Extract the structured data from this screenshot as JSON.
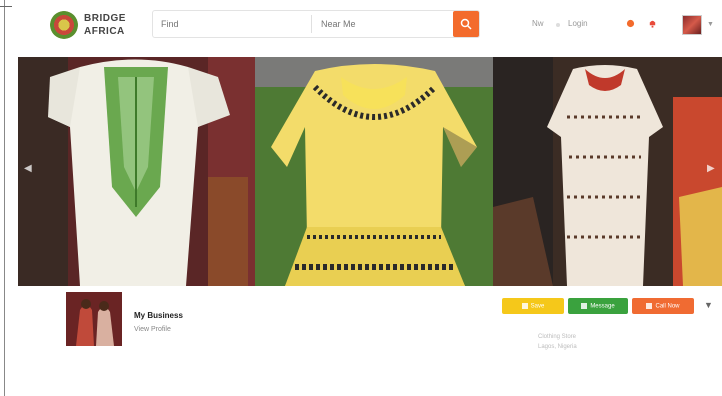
{
  "header": {
    "logo_line1": "BRIDGE",
    "logo_line2": "AFRICA",
    "search": {
      "value": "",
      "placeholder": "Find",
      "location_placeholder": "Near Me"
    },
    "nav": [
      {
        "label": "Nw"
      },
      {
        "label": "Login"
      }
    ]
  },
  "listing": {
    "name": "My Business",
    "subtitle": "View Profile",
    "buttons": {
      "save": "Save",
      "message": "Message",
      "call": "Call Now"
    },
    "meta_line1": "Clothing Store",
    "meta_line2": "Lagos, Nigeria"
  },
  "colors": {
    "accent": "#f36b2c",
    "save": "#f5c81a",
    "message": "#3aa23e",
    "call": "#f06b32"
  }
}
